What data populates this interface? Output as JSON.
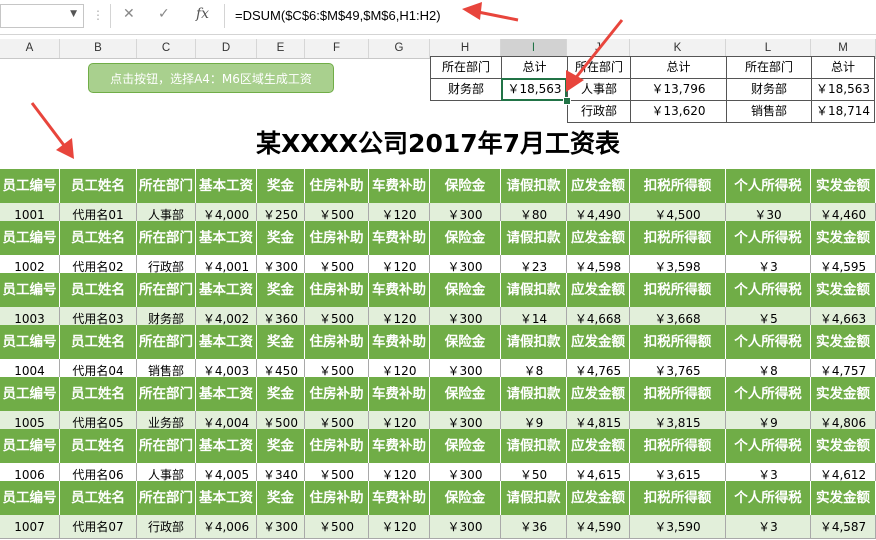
{
  "formula_bar": {
    "name_box": "",
    "cancel_icon": "✕",
    "enter_icon": "✓",
    "fx_label": "fx",
    "formula": "=DSUM($C$6:$M$49,$M$6,H1:H2)"
  },
  "columns": [
    "A",
    "B",
    "C",
    "D",
    "E",
    "F",
    "G",
    "H",
    "I",
    "J",
    "K",
    "L",
    "M"
  ],
  "selected_column": "I",
  "button_label": "点击按钮，选择A4：M6区域生成工资",
  "summary": {
    "header_dept": "所在部门",
    "header_total": "总计",
    "groups": [
      {
        "dept": "财务部",
        "total": "￥18,563"
      },
      {
        "dept": "人事部",
        "total": "￥13,796"
      },
      {
        "dept": "行政部",
        "total": "￥13,620"
      },
      {
        "dept": "财务部",
        "total": "￥18,563"
      },
      {
        "dept": "销售部",
        "total": "￥18,714"
      }
    ]
  },
  "title": "某XXXX公司2017年7月工资表",
  "table": {
    "headers": [
      "员工编号",
      "员工姓名",
      "所在部门",
      "基本工资",
      "奖金",
      "住房补助",
      "车费补助",
      "保险金",
      "请假扣款",
      "应发金额",
      "扣税所得额",
      "个人所得税",
      "实发金额"
    ],
    "rows": [
      [
        "1001",
        "代用名01",
        "人事部",
        "￥4,000",
        "￥250",
        "￥500",
        "￥120",
        "￥300",
        "￥80",
        "￥4,490",
        "￥4,500",
        "￥30",
        "￥4,460"
      ],
      [
        "1002",
        "代用名02",
        "行政部",
        "￥4,001",
        "￥300",
        "￥500",
        "￥120",
        "￥300",
        "￥23",
        "￥4,598",
        "￥3,598",
        "￥3",
        "￥4,595"
      ],
      [
        "1003",
        "代用名03",
        "财务部",
        "￥4,002",
        "￥360",
        "￥500",
        "￥120",
        "￥300",
        "￥14",
        "￥4,668",
        "￥3,668",
        "￥5",
        "￥4,663"
      ],
      [
        "1004",
        "代用名04",
        "销售部",
        "￥4,003",
        "￥450",
        "￥500",
        "￥120",
        "￥300",
        "￥8",
        "￥4,765",
        "￥3,765",
        "￥8",
        "￥4,757"
      ],
      [
        "1005",
        "代用名05",
        "业务部",
        "￥4,004",
        "￥500",
        "￥500",
        "￥120",
        "￥300",
        "￥9",
        "￥4,815",
        "￥3,815",
        "￥9",
        "￥4,806"
      ],
      [
        "1006",
        "代用名06",
        "人事部",
        "￥4,005",
        "￥340",
        "￥500",
        "￥120",
        "￥300",
        "￥50",
        "￥4,615",
        "￥3,615",
        "￥3",
        "￥4,612"
      ],
      [
        "1007",
        "代用名07",
        "行政部",
        "￥4,006",
        "￥300",
        "￥500",
        "￥120",
        "￥300",
        "￥36",
        "￥4,590",
        "￥3,590",
        "￥3",
        "￥4,587"
      ]
    ]
  },
  "colors": {
    "header_green": "#70ad47",
    "band_light_green": "#e2efda",
    "button_green": "#a9d08e",
    "excel_green": "#217346",
    "arrow_red": "#e8453c"
  }
}
